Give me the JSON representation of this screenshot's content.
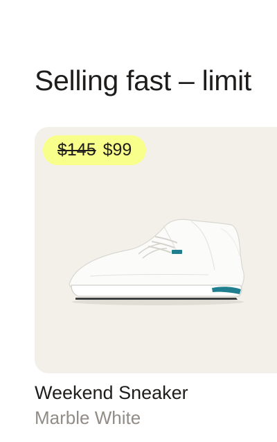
{
  "section": {
    "title": "Selling fast – limit"
  },
  "product": {
    "price_original": "$145",
    "price_sale": "$99",
    "name": "Weekend Sneaker",
    "variant": "Marble White"
  },
  "colors": {
    "badge_background": "#f8ff8a",
    "card_background": "#f2f0e9",
    "shoe_accent": "#1f7f8f"
  },
  "icons": {
    "product_image": "white-sneaker-image"
  }
}
